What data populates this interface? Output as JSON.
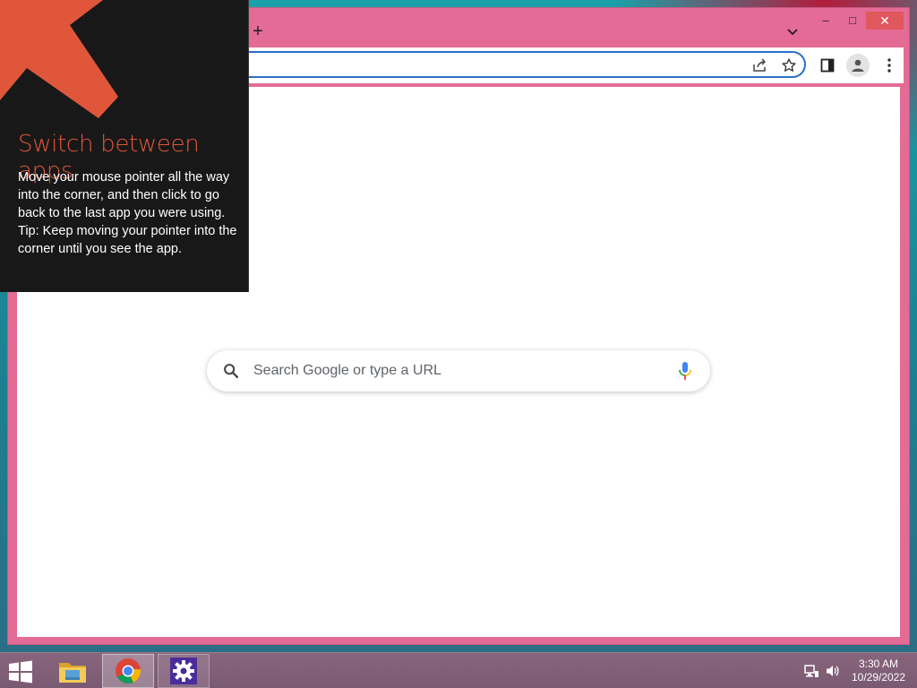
{
  "colors": {
    "browser_frame": "#e46b95",
    "omnibox_border": "#2a6fc9",
    "tip_background": "#181818",
    "tip_accent": "#e0563a",
    "taskbar": "#7a5a73",
    "close_button": "#e0575d"
  },
  "browser": {
    "tabstrip": {
      "new_tab_label": "+",
      "tab_search_icon": "chevron-down-icon"
    },
    "window_controls": {
      "minimize": "–",
      "maximize": "□",
      "close": "✕"
    },
    "toolbar": {
      "icons": [
        "share-icon",
        "bookmark-star-icon",
        "side-panel-icon",
        "profile-icon",
        "menu-icon"
      ]
    },
    "new_tab_page": {
      "search_placeholder": "Search Google or type a URL",
      "icons": [
        "search-icon",
        "microphone-icon"
      ]
    }
  },
  "tip": {
    "title": "Switch between apps",
    "body_lines": [
      "Move your mouse pointer all the way into the corner, and then click to go back to the last app you were using.",
      "Tip: Keep moving your pointer into the corner until you see the app."
    ]
  },
  "taskbar": {
    "apps": [
      "file-explorer-icon",
      "chrome-icon",
      "settings-icon"
    ],
    "tray_icons": [
      "network-icon",
      "volume-icon"
    ],
    "clock": {
      "time": "3:30 AM",
      "date": "10/29/2022"
    }
  }
}
